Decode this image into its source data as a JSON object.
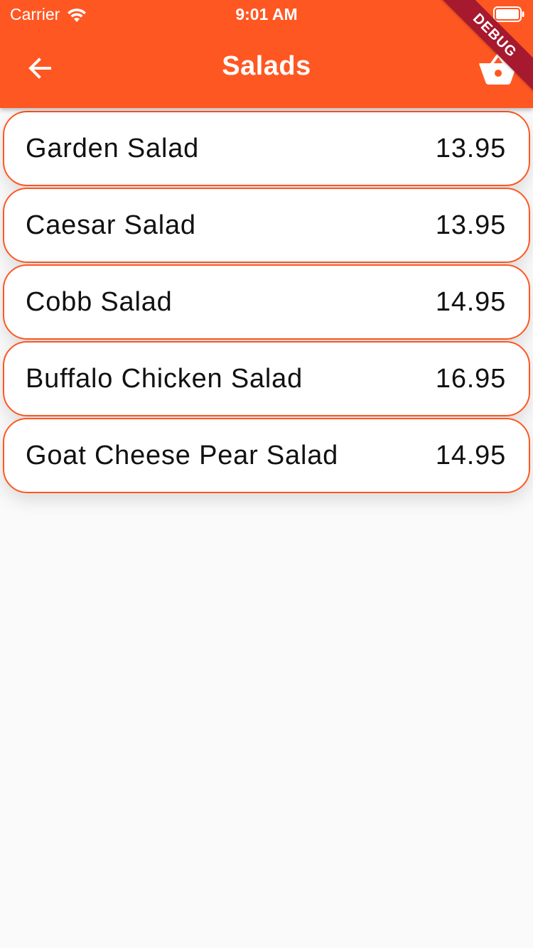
{
  "status_bar": {
    "carrier": "Carrier",
    "time": "9:01 AM",
    "wifi_icon": "wifi-icon",
    "battery_icon": "battery-icon"
  },
  "app_bar": {
    "title": "Salads",
    "back_icon": "arrow-left-icon",
    "cart_icon": "shopping-basket-icon",
    "debug_banner": "DEBUG",
    "color": "#ff5722"
  },
  "menu": {
    "items": [
      {
        "name": "Garden Salad",
        "price": "13.95"
      },
      {
        "name": "Caesar Salad",
        "price": "13.95"
      },
      {
        "name": "Cobb Salad",
        "price": "14.95"
      },
      {
        "name": "Buffalo Chicken Salad",
        "price": "16.95"
      },
      {
        "name": "Goat Cheese Pear Salad",
        "price": "14.95"
      }
    ]
  }
}
